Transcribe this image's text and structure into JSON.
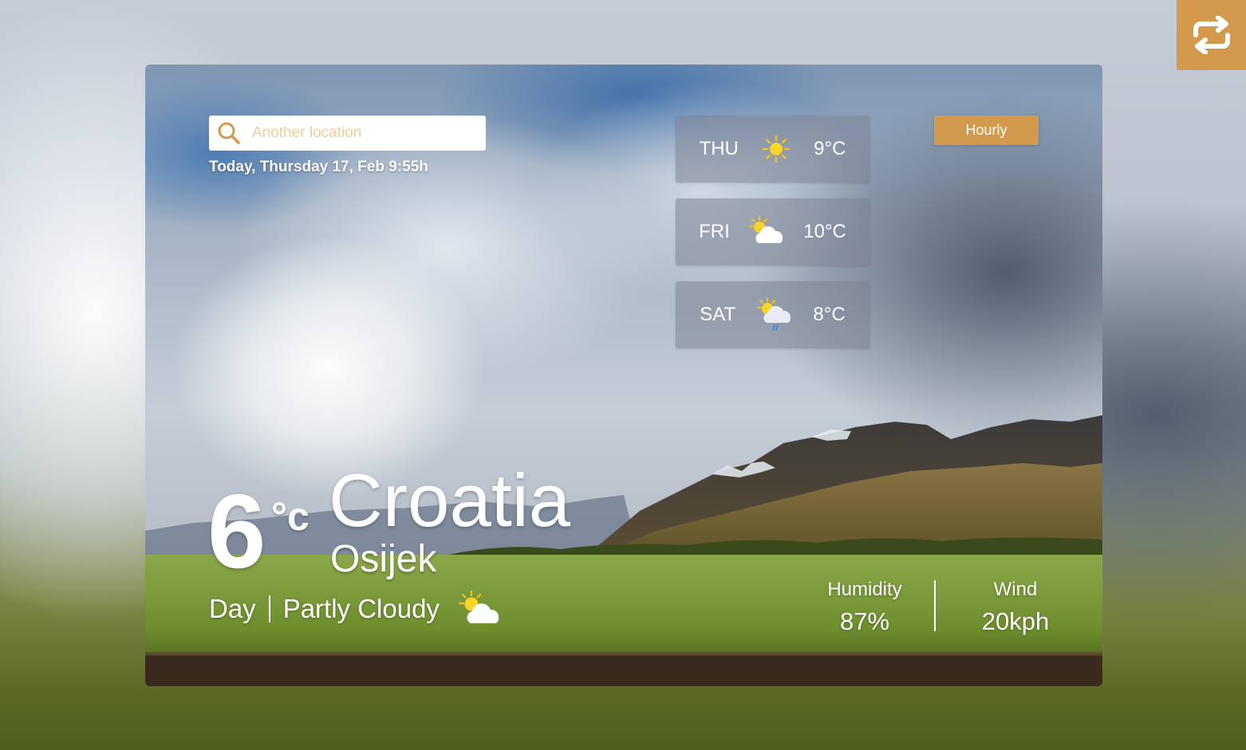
{
  "search": {
    "placeholder": "Another location",
    "icon": "search-icon"
  },
  "date_text": "Today, Thursday 17, Feb 9:55h",
  "hourly_label": "Hourly",
  "swap_icon": "swap-icon",
  "forecast": [
    {
      "day": "THU",
      "temp": "9°C",
      "icon": "sunny-icon"
    },
    {
      "day": "FRI",
      "temp": "10°C",
      "icon": "partly-cloudy-icon"
    },
    {
      "day": "SAT",
      "temp": "8°C",
      "icon": "partly-cloudy-rain-icon"
    }
  ],
  "current": {
    "temp": "6",
    "unit": "°c",
    "country": "Croatia",
    "city": "Osijek",
    "period": "Day",
    "condition": "Partly Cloudy",
    "icon": "partly-cloudy-icon"
  },
  "stats": {
    "humidity_label": "Humidity",
    "humidity_value": "87%",
    "wind_label": "Wind",
    "wind_value": "20kph"
  },
  "colors": {
    "accent": "#d39a4e",
    "text": "#ffffff"
  }
}
